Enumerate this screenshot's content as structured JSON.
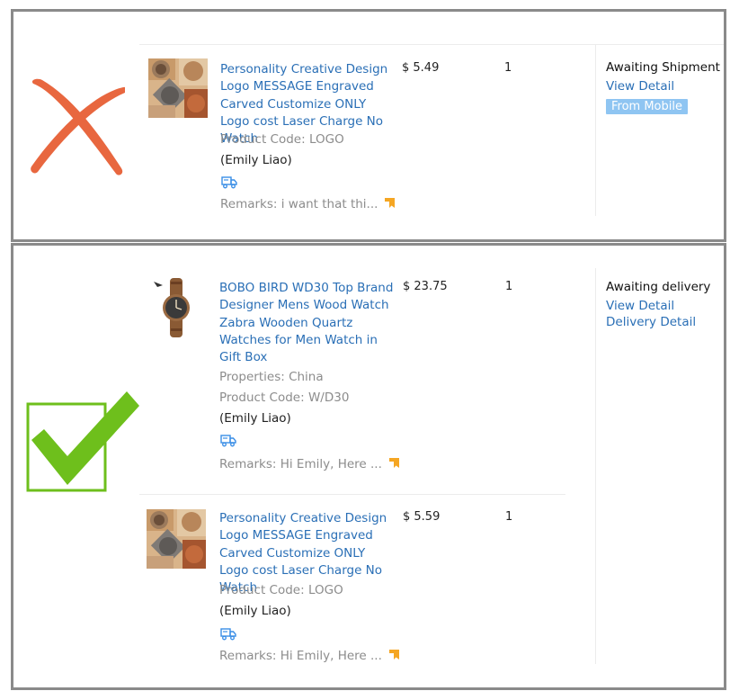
{
  "top_panel": {
    "verdict_icon": "red-cross-icon",
    "item": {
      "title": "Personality Creative Design Logo MESSAGE Engraved Carved Customize ONLY Logo cost Laser Charge No Watch",
      "product_code": "Product Code: LOGO",
      "buyer": "(Emily Liao)",
      "remarks": "Remarks: i want that thi...",
      "price": "$ 5.49",
      "quantity": "1"
    },
    "status": "Awaiting Shipment",
    "view_detail": "View Detail",
    "badge": "From Mobile"
  },
  "bottom_panel": {
    "verdict_icon": "green-checkmark-icon",
    "status": "Awaiting delivery",
    "view_detail": "View Detail",
    "delivery_detail": "Delivery Detail",
    "items": [
      {
        "title": "BOBO BIRD WD30 Top Brand Designer Mens Wood Watch Zabra Wooden Quartz Watches for Men Watch in Gift Box",
        "properties": "Properties: China",
        "product_code": "Product Code: W/D30",
        "buyer": "(Emily Liao)",
        "remarks": "Remarks: Hi Emily, Here ...",
        "price": "$ 23.75",
        "quantity": "1"
      },
      {
        "title": "Personality Creative Design Logo MESSAGE Engraved Carved Customize ONLY Logo cost Laser Charge No Watch",
        "product_code": "Product Code: LOGO",
        "buyer": "(Emily Liao)",
        "remarks": "Remarks: Hi Emily, Here ...",
        "price": "$ 5.59",
        "quantity": "1"
      }
    ]
  },
  "colors": {
    "link": "#2a6fb6",
    "muted": "#8c8c8c",
    "badge": "#8fc5f2",
    "cross": "#e8673f",
    "check": "#6ebf1c",
    "flag": "#f5a623",
    "border": "#8a8a8a"
  }
}
